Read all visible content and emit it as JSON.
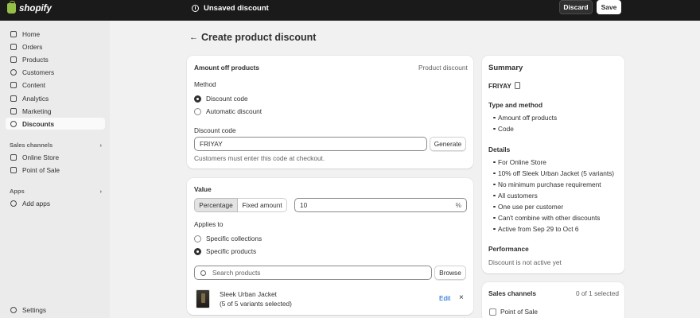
{
  "topbar": {
    "logo_text": "shopify",
    "status": "Unsaved discount",
    "discard_label": "Discard",
    "save_label": "Save"
  },
  "sidebar": {
    "items": [
      {
        "label": "Home"
      },
      {
        "label": "Orders"
      },
      {
        "label": "Products"
      },
      {
        "label": "Customers"
      },
      {
        "label": "Content"
      },
      {
        "label": "Analytics"
      },
      {
        "label": "Marketing"
      },
      {
        "label": "Discounts"
      }
    ],
    "sales_channels_title": "Sales channels",
    "channels": [
      {
        "label": "Online Store"
      },
      {
        "label": "Point of Sale"
      }
    ],
    "apps_title": "Apps",
    "add_apps": "Add apps",
    "settings": "Settings"
  },
  "page": {
    "title": "Create product discount"
  },
  "discount_card": {
    "title": "Amount off products",
    "type": "Product discount",
    "method_label": "Method",
    "method_options": [
      "Discount code",
      "Automatic discount"
    ],
    "code_label": "Discount code",
    "code_value": "FRIYAY",
    "generate_label": "Generate",
    "help": "Customers must enter this code at checkout."
  },
  "value_card": {
    "title": "Value",
    "tabs": [
      "Percentage",
      "Fixed amount"
    ],
    "value": "10",
    "suffix": "%",
    "applies_label": "Applies to",
    "applies_options": [
      "Specific collections",
      "Specific products"
    ],
    "search_placeholder": "Search products",
    "browse_label": "Browse",
    "product_name": "Sleek Urban Jacket",
    "product_variants": "(5 of 5 variants selected)",
    "edit_label": "Edit",
    "remove_label": "×"
  },
  "summary": {
    "title": "Summary",
    "code": "FRIYAY",
    "type_title": "Type and method",
    "type_items": [
      "Amount off products",
      "Code"
    ],
    "details_title": "Details",
    "details_items": [
      "For Online Store",
      "10% off Sleek Urban Jacket (5 variants)",
      "No minimum purchase requirement",
      "All customers",
      "One use per customer",
      "Can't combine with other discounts",
      "Active from Sep 29 to Oct 6"
    ],
    "performance_title": "Performance",
    "performance_text": "Discount is not active yet"
  },
  "sales_channels_card": {
    "title": "Sales channels",
    "count": "0 of 1 selected",
    "channel": "Point of Sale"
  }
}
